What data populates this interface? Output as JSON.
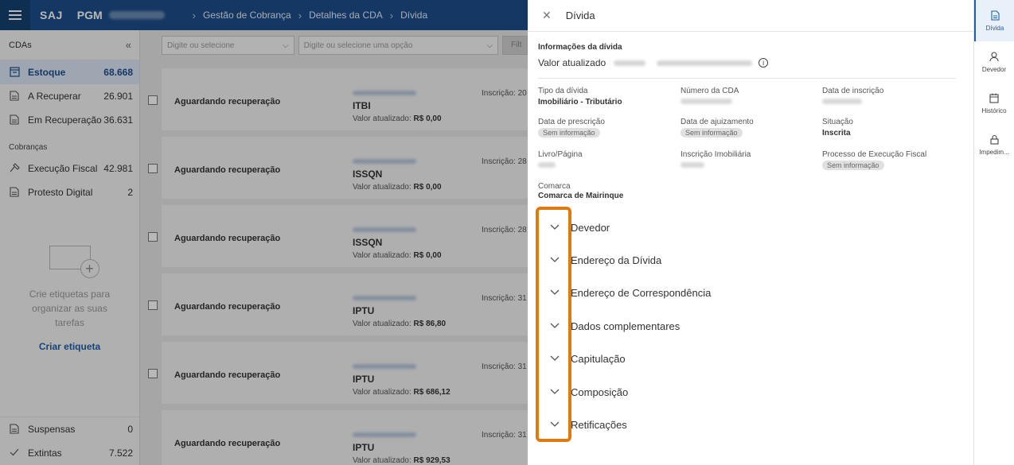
{
  "topbar": {
    "brand": "SAJ",
    "product": "PGM",
    "breadcrumbs": [
      "Gestão de Cobrança",
      "Detalhes da CDA",
      "Dívida"
    ]
  },
  "sidebar": {
    "header": "CDAs",
    "collapse_icon": "double-chevron-left-icon",
    "items": [
      {
        "label": "Estoque",
        "count": "68.668",
        "icon": "inventory-icon"
      },
      {
        "label": "A Recuperar",
        "count": "26.901",
        "icon": "document-icon"
      },
      {
        "label": "Em Recuperação",
        "count": "36.631",
        "icon": "document-icon"
      }
    ],
    "section_cobrancas": "Cobranças",
    "cobrancas": [
      {
        "label": "Execução Fiscal",
        "count": "42.981",
        "icon": "gavel-icon"
      },
      {
        "label": "Protesto Digital",
        "count": "2",
        "icon": "document-icon"
      }
    ],
    "empty_tags_text": "Crie etiquetas para organizar as suas tarefas",
    "create_tag_link": "Criar etiqueta",
    "bottom": [
      {
        "label": "Suspensas",
        "count": "0",
        "icon": "document-icon"
      },
      {
        "label": "Extintas",
        "count": "7.522",
        "icon": "check-icon"
      }
    ]
  },
  "filters": {
    "select1_placeholder": "Digite ou selecione",
    "select2_placeholder": "Digite ou selecione uma opção",
    "button_partial": "Filt"
  },
  "list": {
    "rows": [
      {
        "status": "Aguardando recuperação",
        "tipo": "ITBI",
        "valor_label": "Valor atualizado:",
        "valor": "R$ 0,00",
        "inscricao": "Inscrição: 20"
      },
      {
        "status": "Aguardando recuperação",
        "tipo": "ISSQN",
        "valor_label": "Valor atualizado:",
        "valor": "R$ 0,00",
        "inscricao": "Inscrição: 28 ."
      },
      {
        "status": "Aguardando recuperação",
        "tipo": "ISSQN",
        "valor_label": "Valor atualizado:",
        "valor": "R$ 0,00",
        "inscricao": "Inscrição: 28 ."
      },
      {
        "status": "Aguardando recuperação",
        "tipo": "IPTU",
        "valor_label": "Valor atualizado:",
        "valor": "R$ 86,80",
        "inscricao": "Inscrição: 31 |"
      },
      {
        "status": "Aguardando recuperação",
        "tipo": "IPTU",
        "valor_label": "Valor atualizado:",
        "valor": "R$ 686,12",
        "inscricao": "Inscrição: 31 |"
      },
      {
        "status": "Aguardando recuperação",
        "tipo": "IPTU",
        "valor_label": "Valor atualizado:",
        "valor": "R$ 929,53",
        "inscricao": "Inscrição: 31 |"
      }
    ]
  },
  "panel": {
    "title": "Dívida",
    "info_title": "Informações da dívida",
    "valor_label": "Valor atualizado",
    "fields": {
      "tipo": {
        "label": "Tipo da dívida",
        "value": "Imobiliário - Tributário"
      },
      "numero_cda": {
        "label": "Número da CDA"
      },
      "data_inscricao": {
        "label": "Data de inscrição"
      },
      "data_prescricao": {
        "label": "Data de prescrição",
        "pill": "Sem informação"
      },
      "data_ajuizamento": {
        "label": "Data de ajuizamento",
        "pill": "Sem informação"
      },
      "situacao": {
        "label": "Situação",
        "value": "Inscrita"
      },
      "livro": {
        "label": "Livro/Página"
      },
      "inscricao_imob": {
        "label": "Inscrição Imobiliária"
      },
      "processo": {
        "label": "Processo de Execução Fiscal",
        "pill": "Sem informação"
      },
      "comarca": {
        "label": "Comarca",
        "value": "Comarca de Mairinque"
      }
    },
    "accordions": [
      "Devedor",
      "Endereço da Dívida",
      "Endereço de Correspondência",
      "Dados complementares",
      "Capitulação",
      "Composição",
      "Retificações"
    ]
  },
  "rail": [
    {
      "label": "Dívida",
      "icon": "document-icon",
      "active": true
    },
    {
      "label": "Devedor",
      "icon": "person-icon"
    },
    {
      "label": "Histórico",
      "icon": "calendar-icon"
    },
    {
      "label": "Impedim...",
      "icon": "lock-icon"
    }
  ],
  "colors": {
    "primary": "#1d4e8a",
    "highlight": "#e07a10",
    "link": "#1d5fa8"
  }
}
